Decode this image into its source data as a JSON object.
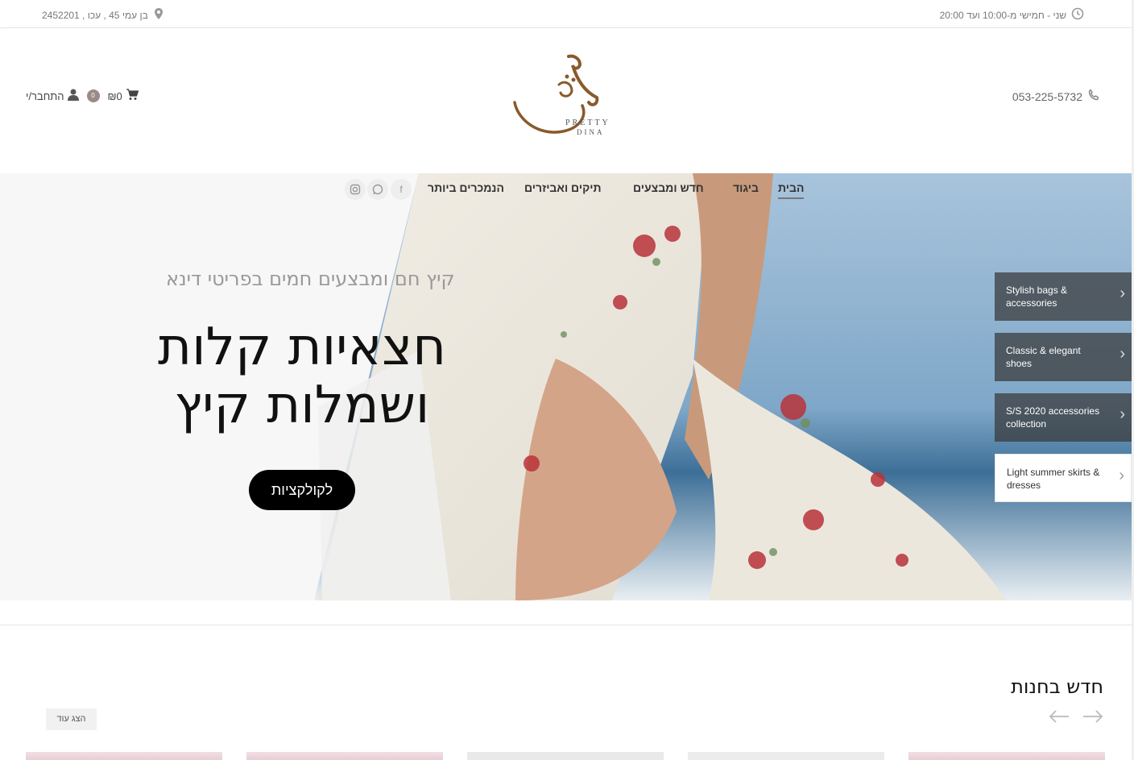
{
  "topbar": {
    "hours": "שני - חמישי מ-10:00 ועד 20:00",
    "address": "בן עמי 45 , עכו , 2452201"
  },
  "header": {
    "phone": "053-225-5732",
    "cart_total": "₪0",
    "cart_count": "0",
    "login_label": "התחבר/י",
    "logo_text_line1": "PRETTY",
    "logo_text_line2": "DINA"
  },
  "nav": {
    "items": [
      {
        "label": "הבית",
        "active": true
      },
      {
        "label": "ביגוד"
      },
      {
        "label": "חדש ומבצעים"
      },
      {
        "label": "תיקים ואביזרים"
      },
      {
        "label": "הנמכרים ביותר"
      }
    ],
    "social": [
      "instagram-icon",
      "whatsapp-icon",
      "facebook-icon"
    ]
  },
  "hero": {
    "subtitle": "קיץ חם ומבצעים חמים בפריטי דינא",
    "title_line1": "חצאיות קלות",
    "title_line2": "ושמלות קיץ",
    "cta": "לקולקציות",
    "side_items": [
      "Stylish bags & accessories",
      "Classic & elegant shoes",
      "S/S 2020 accessories collection",
      "Light summer skirts & dresses"
    ]
  },
  "section": {
    "title": "חדש בחנות",
    "more_label": "הצג עוד"
  },
  "colors": {
    "logo_brown": "#8a5a2b",
    "badge": "#9a8a88",
    "cta_bg": "#000000"
  }
}
